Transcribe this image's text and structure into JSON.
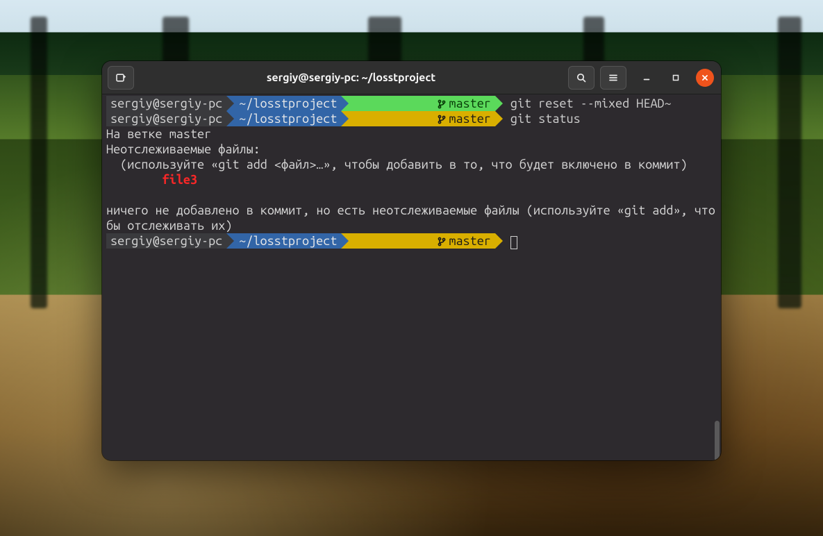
{
  "window": {
    "title": "sergiy@sergiy-pc: ~/losstproject"
  },
  "prompt": {
    "host": "sergiy@sergiy-pc",
    "path": "~/losstproject",
    "branch": "master"
  },
  "lines": {
    "cmd1": "git reset --mixed HEAD~",
    "cmd2": "git status",
    "out1": "На ветке master",
    "out2": "Неотслеживаемые файлы:",
    "out3": "  (используйте «git add <файл>…», чтобы добавить в то, что будет включено в коммит)",
    "file": "file3",
    "out4": "ничего не добавлено в коммит, но есть неотслеживаемые файлы (используйте «git add», чтобы отслеживать их)"
  }
}
